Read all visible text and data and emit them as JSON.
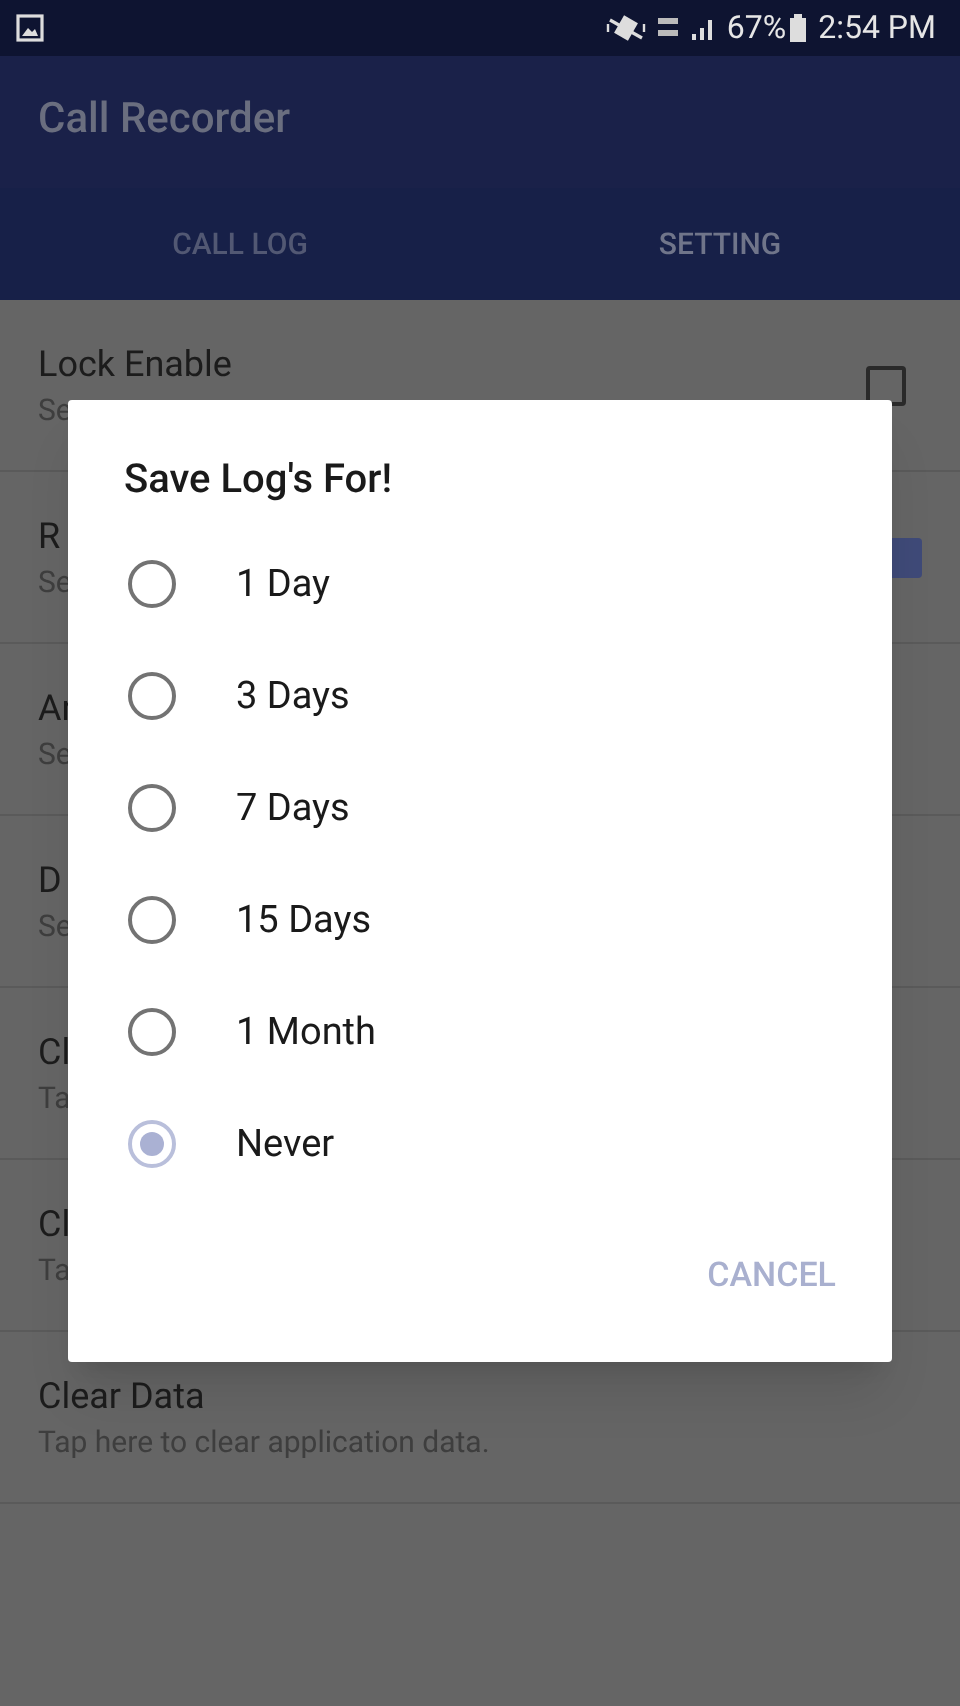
{
  "status_bar": {
    "battery": "67%",
    "time": "2:54 PM"
  },
  "app_bar": {
    "title": "Call Recorder"
  },
  "tabs": [
    {
      "label": "CALL LOG",
      "selected": false
    },
    {
      "label": "SETTING",
      "selected": true
    }
  ],
  "settings": [
    {
      "title": "Lock Enable",
      "subtitle": "Se",
      "kind": "checkbox",
      "checked": false
    },
    {
      "title": "R",
      "subtitle": "Se",
      "kind": "checkbox",
      "checked": true
    },
    {
      "title": "Ar",
      "subtitle": "Se",
      "kind": "plain"
    },
    {
      "title": "D",
      "subtitle": "Se",
      "kind": "plain"
    },
    {
      "title": "Cl",
      "subtitle": "Ta",
      "kind": "plain"
    },
    {
      "title": "Cl",
      "subtitle": "Ta",
      "kind": "plain"
    },
    {
      "title": "Clear Data",
      "subtitle": "Tap here to clear application data.",
      "kind": "plain"
    }
  ],
  "dialog": {
    "title": "Save Log's For!",
    "options": [
      {
        "label": "1 Day",
        "selected": false
      },
      {
        "label": "3 Days",
        "selected": false
      },
      {
        "label": "7 Days",
        "selected": false
      },
      {
        "label": "15 Days",
        "selected": false
      },
      {
        "label": "1 Month",
        "selected": false
      },
      {
        "label": "Never",
        "selected": true
      }
    ],
    "button": "CANCEL"
  }
}
